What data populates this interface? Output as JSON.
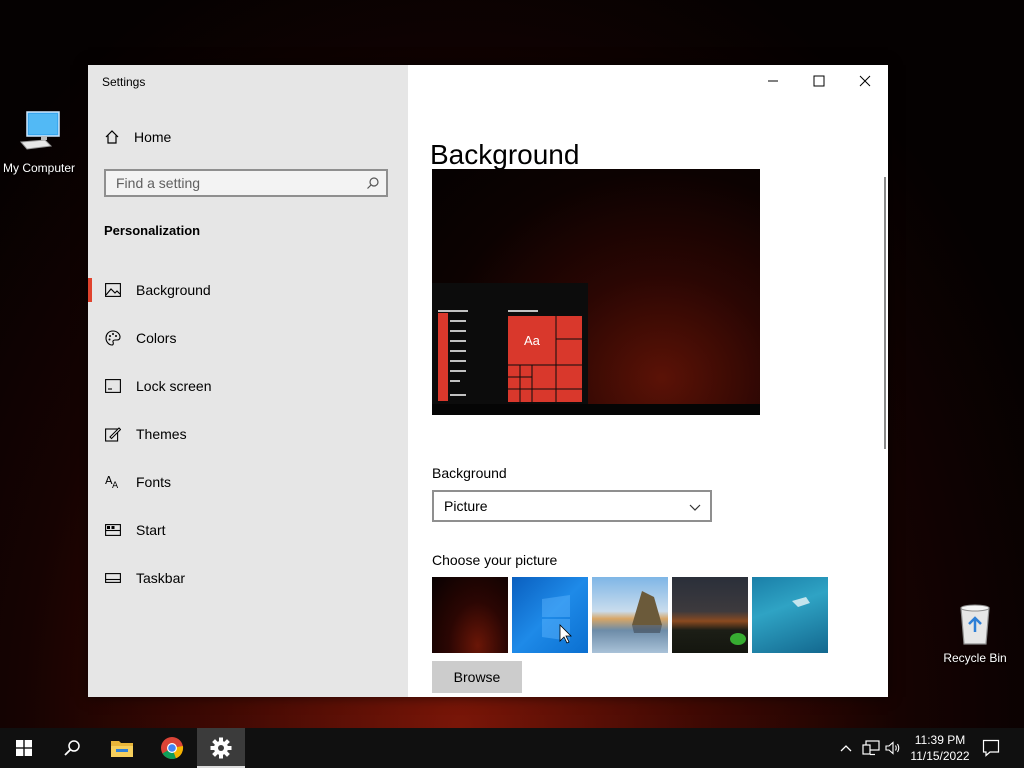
{
  "desktop": {
    "icons": [
      {
        "label": "My Computer"
      },
      {
        "label": "Recycle Bin"
      }
    ]
  },
  "window": {
    "title": "Settings",
    "controls": {
      "minimize": "minimize-icon",
      "maximize": "maximize-icon",
      "close": "close-icon"
    }
  },
  "sidebar": {
    "home_label": "Home",
    "search_placeholder": "Find a setting",
    "section": "Personalization",
    "items": [
      {
        "label": "Background",
        "icon": "picture-icon",
        "active": true
      },
      {
        "label": "Colors",
        "icon": "palette-icon"
      },
      {
        "label": "Lock screen",
        "icon": "lock-screen-icon"
      },
      {
        "label": "Themes",
        "icon": "themes-icon"
      },
      {
        "label": "Fonts",
        "icon": "fonts-icon"
      },
      {
        "label": "Start",
        "icon": "start-icon"
      },
      {
        "label": "Taskbar",
        "icon": "taskbar-icon"
      }
    ]
  },
  "main": {
    "title": "Background",
    "preview": {
      "tile_text": "Aa"
    },
    "background_label": "Background",
    "background_value": "Picture",
    "choose_label": "Choose your picture",
    "browse_label": "Browse"
  },
  "taskbar": {
    "time": "11:39 PM",
    "date": "11/15/2022"
  },
  "colors": {
    "accent": "#e0432e",
    "tile_red": "#d9382c",
    "sidebar_bg": "#e6e6e6",
    "taskbar_bg": "#101010"
  }
}
